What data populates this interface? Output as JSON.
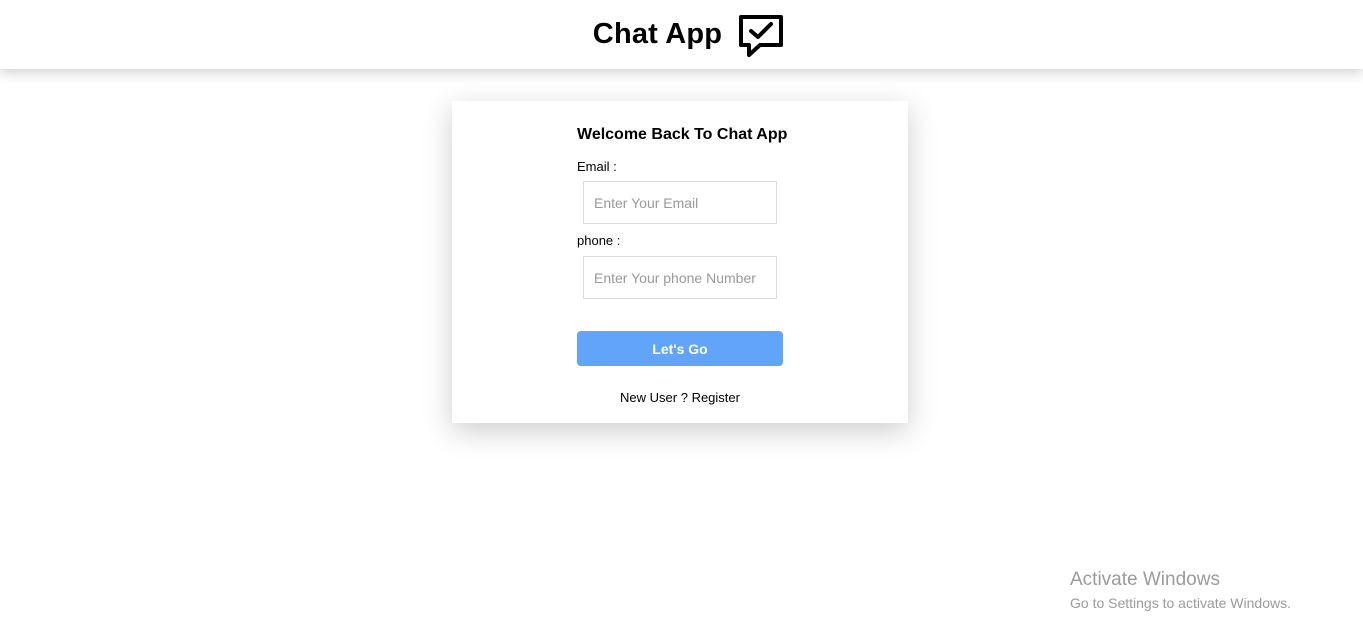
{
  "header": {
    "title": "Chat App",
    "icon": "chat-check-icon"
  },
  "login_card": {
    "title": "Welcome Back To Chat App",
    "email_label": "Email :",
    "email_placeholder": "Enter Your Email",
    "email_value": "",
    "phone_label": "phone :",
    "phone_placeholder": "Enter Your phone Number",
    "phone_value": "",
    "submit_label": "Let's Go",
    "new_user_text": "New User ?",
    "register_label": "Register"
  },
  "watermark": {
    "title": "Activate Windows",
    "subtitle": "Go to Settings to activate Windows."
  },
  "colors": {
    "button": "#60a5fa",
    "watermark": "#9b9b9b"
  }
}
